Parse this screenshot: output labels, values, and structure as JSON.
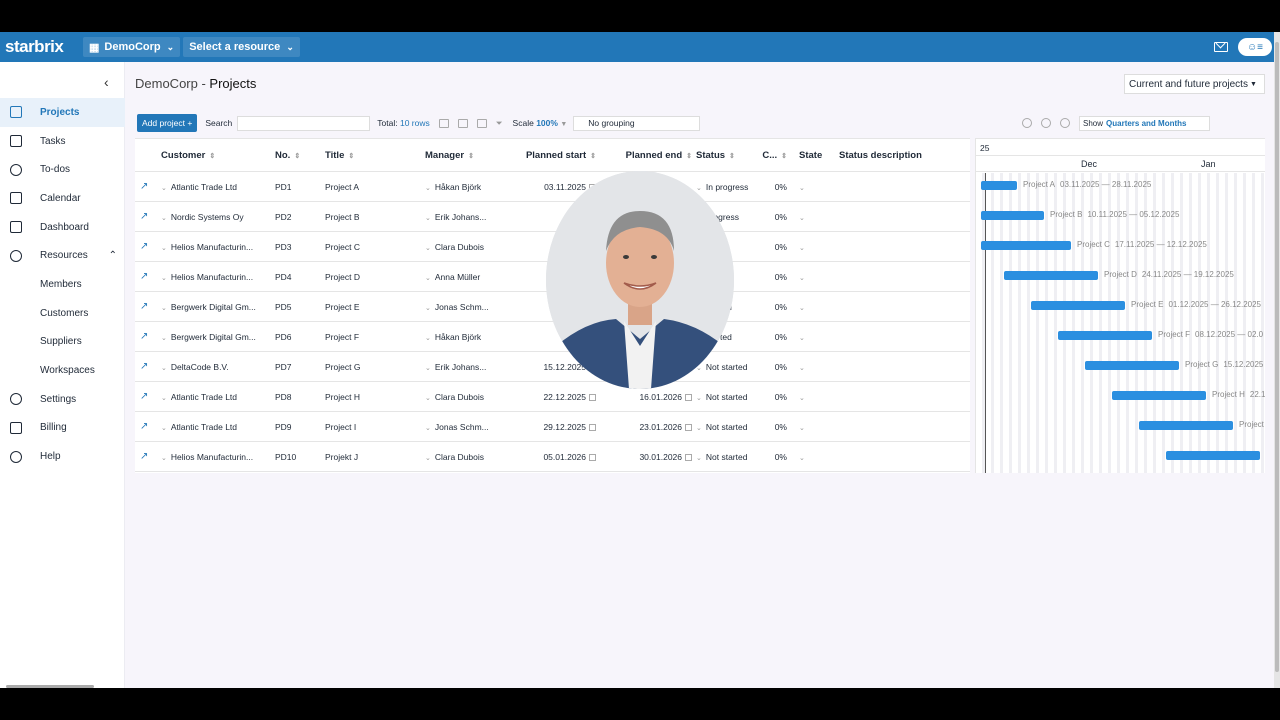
{
  "app": {
    "logo": "starbrix",
    "workspace": "DemoCorp",
    "resource_select": "Select a resource"
  },
  "sidebar": {
    "items": [
      {
        "label": "Projects",
        "icon": "folder-icon",
        "active": true
      },
      {
        "label": "Tasks",
        "icon": "clipboard-icon"
      },
      {
        "label": "To-dos",
        "icon": "check-circle-icon"
      },
      {
        "label": "Calendar",
        "icon": "calendar-icon"
      },
      {
        "label": "Dashboard",
        "icon": "grid-icon"
      },
      {
        "label": "Resources",
        "icon": "users-icon",
        "expanded": true
      },
      {
        "label": "Members",
        "sub": true
      },
      {
        "label": "Customers",
        "sub": true
      },
      {
        "label": "Suppliers",
        "sub": true
      },
      {
        "label": "Workspaces",
        "sub": true
      },
      {
        "label": "Settings",
        "icon": "gear-icon"
      },
      {
        "label": "Billing",
        "icon": "card-icon"
      },
      {
        "label": "Help",
        "icon": "help-icon"
      }
    ]
  },
  "page": {
    "crumb": "DemoCorp",
    "separator": " - ",
    "title": "Projects",
    "filter": "Current and future projects"
  },
  "toolbar": {
    "add_label": "Add project +",
    "search_label": "Search",
    "total_label": "Total:",
    "total_count": "10 rows",
    "scale_label": "Scale",
    "scale_value": "100%",
    "grouping": "No grouping"
  },
  "gantt_toolbar": {
    "show_label": "Show",
    "show_value": "Quarters and Months"
  },
  "table": {
    "columns": [
      "Customer",
      "No.",
      "Title",
      "Manager",
      "Planned start",
      "Planned end",
      "Status",
      "C...",
      "State",
      "Status description"
    ],
    "rows": [
      {
        "customer": "Atlantic Trade Ltd",
        "no": "PD1",
        "title": "Project A",
        "manager": "Håkan Björk",
        "start": "03.11.2025",
        "end": "",
        "status": "In progress",
        "c": "0%"
      },
      {
        "customer": "Nordic Systems Oy",
        "no": "PD2",
        "title": "Project B",
        "manager": "Erik Johans...",
        "start": "10.11.2",
        "end": "",
        "status": "progress",
        "c": "0%"
      },
      {
        "customer": "Helios Manufacturin...",
        "no": "PD3",
        "title": "Project C",
        "manager": "Clara Dubois",
        "start": "17.1",
        "end": "",
        "status": "gress",
        "c": "0%"
      },
      {
        "customer": "Helios Manufacturin...",
        "no": "PD4",
        "title": "Project D",
        "manager": "Anna Müller",
        "start": "24",
        "end": "",
        "status": "rted",
        "c": "0%"
      },
      {
        "customer": "Bergwerk Digital Gm...",
        "no": "PD5",
        "title": "Project E",
        "manager": "Jonas Schm...",
        "start": "01.",
        "end": "",
        "status": "started",
        "c": "0%"
      },
      {
        "customer": "Bergwerk Digital Gm...",
        "no": "PD6",
        "title": "Project F",
        "manager": "Håkan Björk",
        "start": "08.12.",
        "end": "",
        "status": "started",
        "c": "0%"
      },
      {
        "customer": "DeltaCode B.V.",
        "no": "PD7",
        "title": "Project G",
        "manager": "Erik Johans...",
        "start": "15.12.2025",
        "end": "",
        "status": "Not started",
        "c": "0%"
      },
      {
        "customer": "Atlantic Trade Ltd",
        "no": "PD8",
        "title": "Project H",
        "manager": "Clara Dubois",
        "start": "22.12.2025",
        "end": "16.01.2026",
        "status": "Not started",
        "c": "0%"
      },
      {
        "customer": "Atlantic Trade Ltd",
        "no": "PD9",
        "title": "Project I",
        "manager": "Jonas Schm...",
        "start": "29.12.2025",
        "end": "23.01.2026",
        "status": "Not started",
        "c": "0%"
      },
      {
        "customer": "Helios Manufacturin...",
        "no": "PD10",
        "title": "Projekt J",
        "manager": "Clara Dubois",
        "start": "05.01.2026",
        "end": "30.01.2026",
        "status": "Not started",
        "c": "0%"
      }
    ]
  },
  "gantt": {
    "year_label": "25",
    "months": [
      "Dec",
      "Jan"
    ],
    "bars": [
      {
        "label": "Project A",
        "dates": "03.11.2025 — 28.11.2025"
      },
      {
        "label": "Project B",
        "dates": "10.11.2025 — 05.12.2025"
      },
      {
        "label": "Project C",
        "dates": "17.11.2025 — 12.12.2025"
      },
      {
        "label": "Project D",
        "dates": "24.11.2025 — 19.12.2025"
      },
      {
        "label": "Project E",
        "dates": "01.12.2025 — 26.12.2025"
      },
      {
        "label": "Project F",
        "dates": "08.12.2025 — 02.0"
      },
      {
        "label": "Project G",
        "dates": "15.12.2025"
      },
      {
        "label": "Project H",
        "dates": "22.1"
      },
      {
        "label": "Project",
        "dates": ""
      },
      {
        "label": "",
        "dates": ""
      }
    ]
  },
  "colors": {
    "brand": "#2277b8",
    "bar": "#2b8fe0"
  }
}
